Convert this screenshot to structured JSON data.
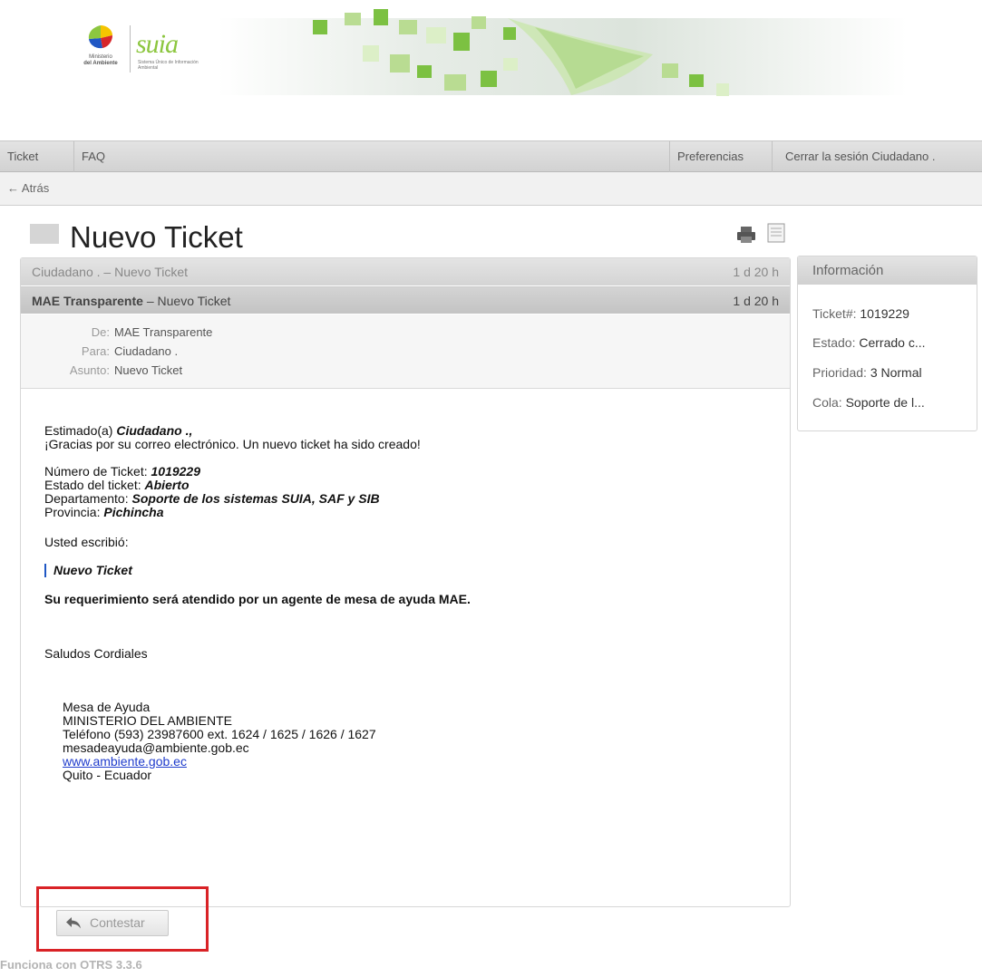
{
  "logo": {
    "ministerio_line1": "Ministerio",
    "ministerio_line2": "del Ambiente",
    "suia": "suia",
    "suia_sub": "Sistema Único de Información Ambiental"
  },
  "nav": {
    "ticket": "Ticket",
    "faq": "FAQ",
    "preferences": "Preferencias",
    "logout": "Cerrar la sesión Ciudadano ."
  },
  "back": "← Atrás",
  "page_title": "Nuevo Ticket",
  "articles": [
    {
      "from": "Ciudadano .",
      "sep": " – ",
      "subject": "Nuevo Ticket",
      "age": "1 d 20 h"
    },
    {
      "from": "MAE Transparente",
      "sep": " – ",
      "subject": "Nuevo Ticket",
      "age": "1 d 20 h"
    }
  ],
  "headers": {
    "from_label": "De:",
    "from_value": "MAE Transparente",
    "to_label": "Para:",
    "to_value": "Ciudadano .",
    "subject_label": "Asunto:",
    "subject_value": "Nuevo Ticket"
  },
  "body": {
    "greeting_prefix": "Estimado(a) ",
    "greeting_name": "Ciudadano .,",
    "thanks": "¡Gracias por su correo electrónico. Un nuevo ticket ha sido creado!",
    "ticket_number_label": "Número de Ticket: ",
    "ticket_number": "1019229",
    "state_label": "Estado del ticket: ",
    "state": "Abierto",
    "department_label": "Departamento: ",
    "department": "Soporte de los sistemas SUIA, SAF y SIB",
    "province_label": "Provincia: ",
    "province": "Pichincha",
    "you_wrote": "Usted escribió:",
    "quote": "Nuevo Ticket",
    "notice": "Su requerimiento será atendido por un agente de mesa de ayuda MAE.",
    "regards": "Saludos Cordiales"
  },
  "signature": {
    "line1": "Mesa de Ayuda",
    "line2": "MINISTERIO DEL AMBIENTE",
    "line3": "Teléfono (593) 23987600 ext. 1624 / 1625 / 1626 / 1627",
    "line4": "mesadeayuda@ambiente.gob.ec",
    "link": "www.ambiente.gob.ec",
    "line6": "Quito - Ecuador"
  },
  "reply_button": "Contestar",
  "footer": "Funciona con OTRS 3.3.6",
  "info": {
    "title": "Información",
    "ticket_label": "Ticket#: ",
    "ticket_value": "1019229",
    "state_label": "Estado: ",
    "state_value": "Cerrado c...",
    "priority_label": "Prioridad: ",
    "priority_value": "3 Normal",
    "queue_label": "Cola: ",
    "queue_value": "Soporte de l..."
  },
  "colors": {
    "accent_green": "#7cc142",
    "highlight_red": "#d92226",
    "link_blue": "#1f3ccc"
  },
  "icons": {
    "print": "print-icon",
    "plain": "plain-view-icon",
    "reply": "reply-arrow-icon"
  }
}
